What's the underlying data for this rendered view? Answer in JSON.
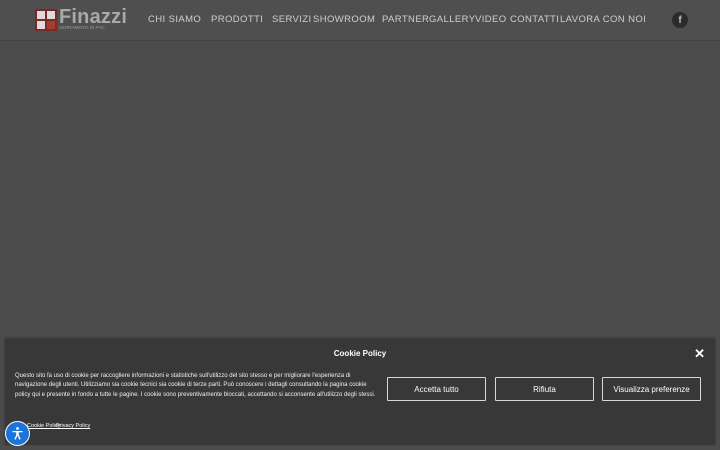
{
  "header": {
    "logo": {
      "name": "Finazzi",
      "tagline": "SERRAMENTI IN PVC"
    },
    "nav": [
      {
        "label": "CHI SIAMO"
      },
      {
        "label": "PRODOTTI"
      },
      {
        "label": "SERVIZI"
      },
      {
        "label": "SHOWROOM"
      },
      {
        "label": "PARTNER"
      },
      {
        "label": "GALLERY"
      },
      {
        "label": "VIDEO"
      },
      {
        "label": "CONTATTI"
      },
      {
        "label": "LAVORA CON NOI"
      }
    ],
    "social": {
      "icon": "facebook-icon",
      "glyph": "f"
    }
  },
  "cookie_banner": {
    "title": "Cookie Policy",
    "close_glyph": "✕",
    "text": "Questo sito fa uso di cookie per raccogliere informazioni e statistiche sull'utilizzo del sito stesso e per migliorare l'esperienza di navigazione degli utenti. Utilizziamo sia cookie tecnici sia cookie di terze parti. Può conoscere i dettagli consultando la pagina cookie policy qui e presente in fondo a tutte le pagine. I cookie sono preventivamente bloccati, accettando si acconsente all'utilizzo degli stessi.",
    "buttons": {
      "accept": "Accetta tutto",
      "reject": "Rifiuta",
      "preferences": "Visualizza preferenze"
    },
    "links": {
      "cookie_policy": "Cookie Policy",
      "privacy_policy": "Privacy Policy"
    }
  },
  "accessibility": {
    "icon": "accessibility-icon",
    "glyph": "⛹"
  },
  "colors": {
    "page_bg": "#4c4c4c",
    "banner_bg": "#383838",
    "accessibility_blue": "#1b74d8"
  }
}
